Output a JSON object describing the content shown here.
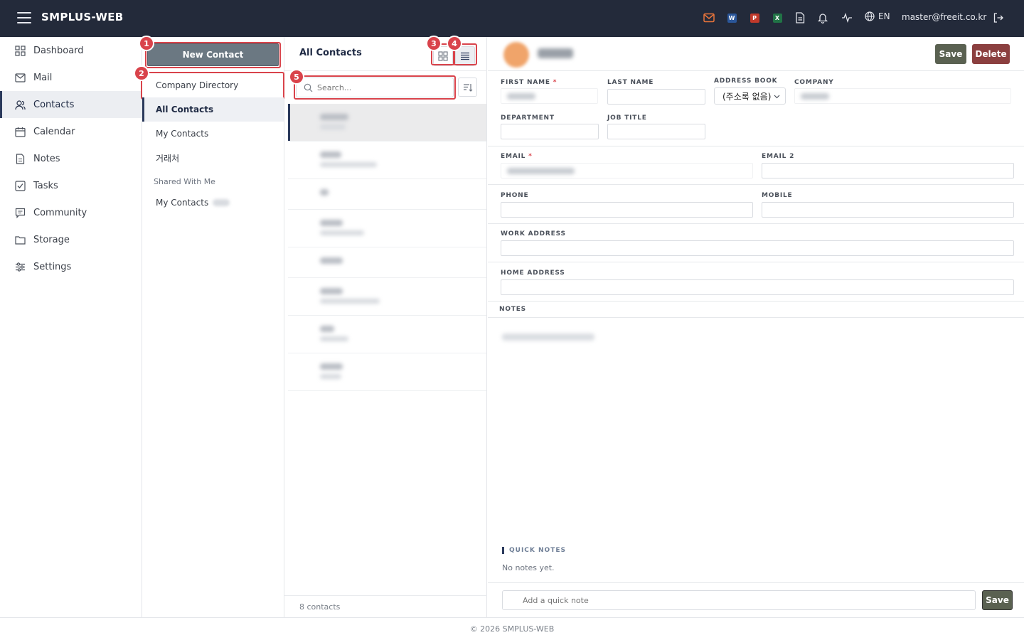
{
  "app": {
    "title": "SMPLUS-WEB"
  },
  "topbar": {
    "language": "EN",
    "user_email": "master@freeit.co.kr",
    "icons": [
      "menu-icon",
      "mail-icon",
      "word-icon",
      "powerpoint-icon",
      "excel-icon",
      "document-icon",
      "bell-icon",
      "activity-icon",
      "globe-icon",
      "logout-icon"
    ],
    "word_letter": "W",
    "ppt_letter": "P",
    "excel_letter": "X",
    "colors": {
      "bar": "#232a3a",
      "mail": "#e8743a",
      "word": "#2b579a",
      "ppt": "#c0392b",
      "excel": "#217346"
    }
  },
  "nav": {
    "items": [
      {
        "label": "Dashboard",
        "icon": "grid-icon"
      },
      {
        "label": "Mail",
        "icon": "mail-icon"
      },
      {
        "label": "Contacts",
        "icon": "contacts-icon",
        "active": true
      },
      {
        "label": "Calendar",
        "icon": "calendar-icon"
      },
      {
        "label": "Notes",
        "icon": "notes-icon"
      },
      {
        "label": "Tasks",
        "icon": "tasks-icon"
      },
      {
        "label": "Community",
        "icon": "community-icon"
      },
      {
        "label": "Storage",
        "icon": "folder-icon"
      },
      {
        "label": "Settings",
        "icon": "settings-icon"
      }
    ]
  },
  "books": {
    "new_contact": "New Contact",
    "company_directory": "Company Directory",
    "all_contacts": "All Contacts",
    "my_contacts": "My Contacts",
    "partners": "거래처",
    "shared_label": "Shared With Me",
    "shared_my_contacts": "My Contacts"
  },
  "annotations": [
    "1",
    "2",
    "3",
    "4",
    "5"
  ],
  "list": {
    "title": "All Contacts",
    "search_placeholder": "Search...",
    "count_text": "8 contacts",
    "view_modes": [
      "grid-view-icon",
      "list-view-icon"
    ]
  },
  "detail": {
    "save_label": "Save",
    "delete_label": "Delete",
    "fields": {
      "first_name": "FIRST NAME",
      "last_name": "LAST NAME",
      "address_book": "ADDRESS BOOK",
      "company": "COMPANY",
      "department": "DEPARTMENT",
      "job_title": "JOB TITLE",
      "email": "EMAIL",
      "email2": "EMAIL 2",
      "phone": "PHONE",
      "mobile": "MOBILE",
      "work_address": "WORK ADDRESS",
      "home_address": "HOME ADDRESS",
      "notes": "NOTES"
    },
    "required_mark": "*",
    "address_book_value": "(주소록 없음)",
    "quick_notes_title": "QUICK NOTES",
    "quick_notes_empty": "No notes yet.",
    "quick_note_placeholder": "Add a quick note",
    "quick_note_save": "Save"
  },
  "footer": {
    "text": "© 2026 SMPLUS-WEB"
  }
}
